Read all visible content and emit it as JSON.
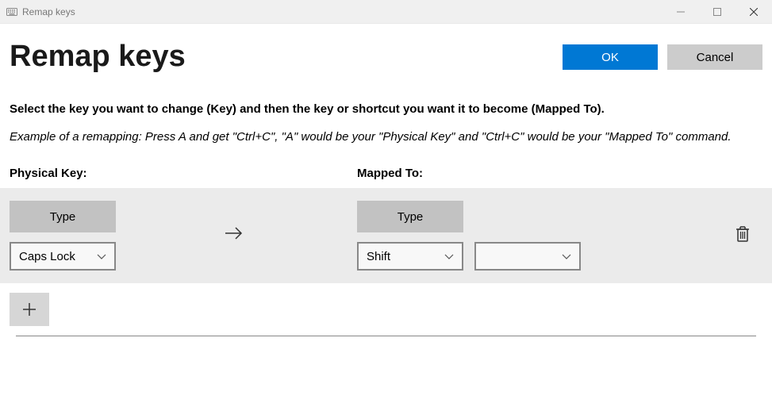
{
  "window": {
    "title": "Remap keys"
  },
  "header": {
    "title": "Remap keys",
    "ok_label": "OK",
    "cancel_label": "Cancel"
  },
  "instructions": {
    "main": "Select the key you want to change (Key) and then the key or shortcut you want it to become (Mapped To).",
    "example": "Example of a remapping: Press A and get \"Ctrl+C\", \"A\" would be your \"Physical Key\" and \"Ctrl+C\" would be your \"Mapped To\" command."
  },
  "columns": {
    "physical": "Physical Key:",
    "mapped": "Mapped To:"
  },
  "row": {
    "type_label": "Type",
    "physical_selected": "Caps Lock",
    "mapped_selected": "Shift",
    "mapped_extra": ""
  }
}
